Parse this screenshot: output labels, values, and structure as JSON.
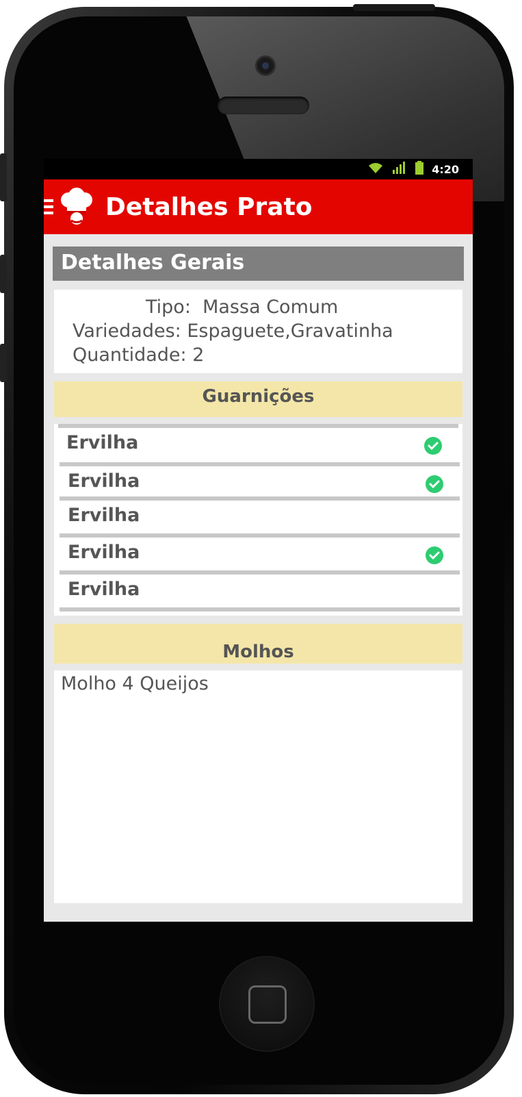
{
  "status_bar": {
    "time": "4:20",
    "wifi_icon": "wifi-icon",
    "signal_icon": "signal-icon",
    "battery_icon": "battery-icon"
  },
  "app_bar": {
    "title": "Detalhes Prato",
    "menu_icon": "menu-icon",
    "logo_icon": "chef-hat-icon",
    "color": "#e30600"
  },
  "general": {
    "header": "Detalhes Gerais",
    "tipo_label": "Tipo:",
    "tipo_value": "Massa Comum",
    "variedades_label": "Variedades:",
    "variedades_value": "Espaguete,Gravatinha",
    "quantidade_label": "Quantidade:",
    "quantidade_value": "2"
  },
  "garnishes": {
    "header": "Guarnições",
    "items": [
      {
        "label": "Ervilha",
        "checked": true
      },
      {
        "label": "Ervilha",
        "checked": true
      },
      {
        "label": "Ervilha",
        "checked": false
      },
      {
        "label": "Ervilha",
        "checked": true
      },
      {
        "label": "Ervilha",
        "checked": false
      }
    ]
  },
  "sauces": {
    "header": "Molhos",
    "value": "Molho 4 Queijos"
  },
  "colors": {
    "check": "#2ecc71",
    "band": "#f4e6a8",
    "gray_header": "#7f7f7f"
  }
}
